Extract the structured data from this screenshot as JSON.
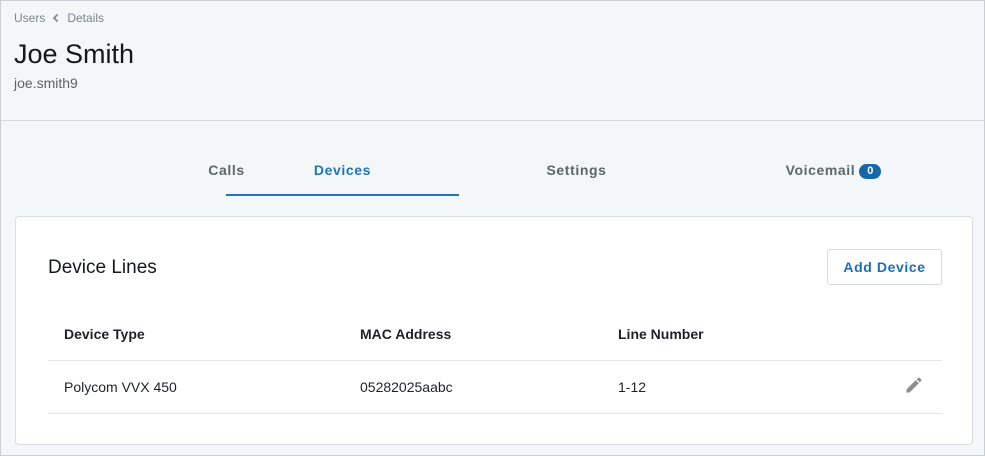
{
  "breadcrumb": {
    "parent": "Users",
    "current": "Details"
  },
  "user": {
    "name": "Joe Smith",
    "username": "joe.smith9"
  },
  "tabs": [
    {
      "label": "Calls",
      "active": false
    },
    {
      "label": "Devices",
      "active": true
    },
    {
      "label": "Settings",
      "active": false
    },
    {
      "label": "Voicemail",
      "active": false,
      "badge": "0"
    }
  ],
  "card": {
    "title": "Device Lines",
    "add_button_label": "Add Device"
  },
  "table": {
    "headers": [
      "Device Type",
      "MAC Address",
      "Line Number"
    ],
    "rows": [
      {
        "device_type": "Polycom VVX 450",
        "mac": "05282025aabc",
        "line": "1-12"
      }
    ]
  },
  "icons": {
    "breadcrumb_separator": "chevron-left-icon",
    "row_action": "pencil-icon"
  },
  "colors": {
    "accent": "#1f76b5",
    "badge": "#1467a8",
    "icon": "#8a8f94"
  }
}
